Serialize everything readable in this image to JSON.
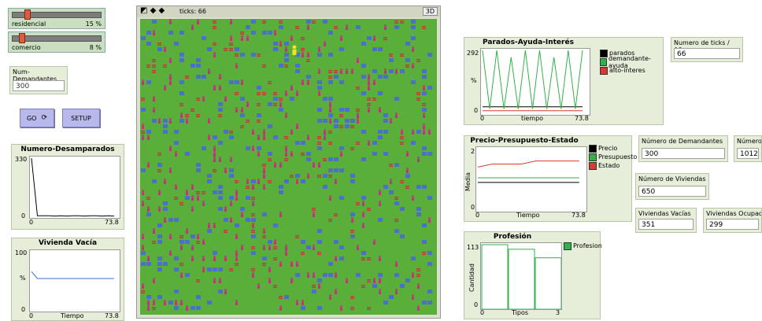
{
  "sliders": [
    {
      "label": "residencial",
      "value": "15 %",
      "fraction": 0.15
    },
    {
      "label": "comercio",
      "value": "8 %",
      "fraction": 0.08
    }
  ],
  "num_demandantes": {
    "label": "Num-Demandantes",
    "value": "300"
  },
  "buttons": {
    "go": "GO",
    "go_icon": "forever-icon",
    "setup": "SETUP"
  },
  "view": {
    "ticks_label": "ticks: 66",
    "three_d": "3D"
  },
  "plots": {
    "desamparados": {
      "title": "Numero-Desamparados",
      "ymax": "330",
      "ymin": "0",
      "xmin": "0",
      "xmax": "73.8"
    },
    "vivienda_vacia": {
      "title": "Vivienda Vacía",
      "ymax": "100",
      "ymin": "0",
      "xmin": "0",
      "xmax": "73.8",
      "xlabel": "Tiempo",
      "ylabel": "%"
    },
    "parados": {
      "title": "Parados-Ayuda-Interés",
      "ymax": "292",
      "ymin": "0",
      "xmin": "0",
      "xmax": "73.8",
      "xlabel": "tiempo",
      "ylabel": "%",
      "legend": [
        {
          "name": "parados",
          "color": "#000000"
        },
        {
          "name": "demandante-ayuda",
          "color": "#2db34a"
        },
        {
          "name": "alto-interes",
          "color": "#d73b2f"
        }
      ]
    },
    "precio": {
      "title": "Precio-Presupuesto-Estado",
      "ymax": "2",
      "ymin": "0",
      "xmin": "0",
      "xmax": "73.8",
      "xlabel": "Tiempo",
      "ylabel": "Media",
      "legend": [
        {
          "name": "Precio",
          "color": "#000000"
        },
        {
          "name": "Presupuesto",
          "color": "#2db34a"
        },
        {
          "name": "Estado",
          "color": "#d73b2f"
        }
      ]
    },
    "profesion": {
      "title": "Profesión",
      "ymax": "113",
      "ymin": "0",
      "xmin": "0",
      "xmax": "3",
      "xlabel": "Tipos",
      "ylabel": "Cantidad",
      "legend": [
        {
          "name": "Profesion",
          "color": "#2db34a"
        }
      ]
    }
  },
  "monitors": {
    "ticks_anos": {
      "label": "Numero de ticks / Años",
      "value": "66"
    },
    "demandantes": {
      "label": "Número de Demandantes",
      "value": "300"
    },
    "numero_cut": {
      "label": "Número",
      "value": "1012"
    },
    "viviendas": {
      "label": "Número de Viviendas",
      "value": "650"
    },
    "vacias": {
      "label": "Viviendas Vacías",
      "value": "351"
    },
    "ocupadas": {
      "label": "Viviendas Ocupada",
      "value": "299"
    }
  },
  "colors": {
    "grass": "#5aaf3a",
    "house": "#4a70c8",
    "person": "#c2347a",
    "commerce": "#c23a3a",
    "turtle_yellow": "#f2e12e"
  },
  "chart_data": [
    {
      "type": "line",
      "title": "Numero-Desamparados",
      "ylim": [
        0,
        330
      ],
      "xlim": [
        0,
        73.8
      ],
      "series": [
        {
          "values": [
            330,
            3,
            3,
            3,
            2,
            3,
            2,
            3,
            3,
            2,
            3,
            3,
            2,
            3,
            2
          ]
        }
      ]
    },
    {
      "type": "line",
      "title": "Vivienda Vacía",
      "xlabel": "Tiempo",
      "ylabel": "%",
      "ylim": [
        0,
        100
      ],
      "xlim": [
        0,
        73.8
      ],
      "series": [
        {
          "values": [
            66,
            54,
            54,
            54,
            54,
            54,
            54,
            54,
            54,
            54,
            54,
            54,
            54,
            54,
            54
          ]
        }
      ]
    },
    {
      "type": "line",
      "title": "Parados-Ayuda-Interés",
      "xlabel": "tiempo",
      "ylabel": "%",
      "ylim": [
        0,
        292
      ],
      "xlim": [
        0,
        73.8
      ],
      "series": [
        {
          "name": "parados",
          "values": [
            30,
            30,
            30,
            30,
            30,
            30,
            30,
            30,
            30,
            30,
            30,
            30,
            30,
            30,
            30
          ]
        },
        {
          "name": "demandante-ayuda",
          "values": [
            292,
            20,
            292,
            20,
            260,
            20,
            292,
            20,
            292,
            20,
            260,
            20,
            292,
            20,
            292
          ]
        },
        {
          "name": "alto-interes",
          "values": [
            12,
            12,
            12,
            12,
            12,
            12,
            12,
            12,
            12,
            12,
            12,
            12,
            12,
            12,
            12
          ]
        }
      ]
    },
    {
      "type": "line",
      "title": "Precio-Presupuesto-Estado",
      "xlabel": "Tiempo",
      "ylabel": "Media",
      "ylim": [
        0,
        2
      ],
      "xlim": [
        0,
        73.8
      ],
      "series": [
        {
          "name": "Precio",
          "values": [
            0.9,
            0.9,
            0.9,
            0.9,
            0.9,
            0.9,
            0.9,
            0.9
          ]
        },
        {
          "name": "Presupuesto",
          "values": [
            1.05,
            1.05,
            1.05,
            1.05,
            1.05,
            1.05,
            1.05,
            1.05
          ]
        },
        {
          "name": "Estado",
          "values": [
            1.4,
            1.5,
            1.5,
            1.5,
            1.6,
            1.6,
            1.6,
            1.6
          ]
        }
      ]
    },
    {
      "type": "bar",
      "title": "Profesión",
      "xlabel": "Tipos",
      "ylabel": "Cantidad",
      "ylim": [
        0,
        113
      ],
      "xlim": [
        0,
        3
      ],
      "categories": [
        "0",
        "1",
        "2"
      ],
      "series": [
        {
          "name": "Profesion",
          "values": [
            113,
            105,
            90
          ]
        }
      ]
    }
  ]
}
